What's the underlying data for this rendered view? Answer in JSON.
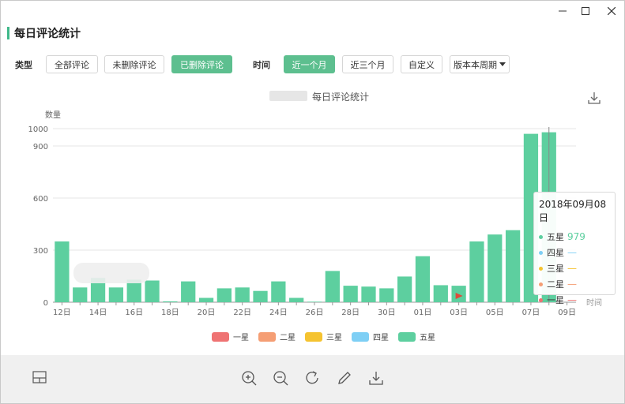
{
  "window": {
    "controls": {
      "minimize": "minimize",
      "maximize": "maximize",
      "close": "close"
    }
  },
  "page_title": "每日评论统计",
  "filters": {
    "type_label": "类型",
    "type_options": [
      "全部评论",
      "未删除评论",
      "已删除评论"
    ],
    "type_selected": "已删除评论",
    "time_label": "时间",
    "time_options": [
      "近一个月",
      "近三个月",
      "自定义"
    ],
    "time_selected": "近一个月",
    "version_dropdown": "版本本周期"
  },
  "chart_title": "每日评论统计",
  "colors": {
    "five": "#5dcf9f",
    "four": "#7ecff5",
    "three": "#f5c330",
    "two": "#f59e74",
    "one": "#ef7373",
    "accent": "#5dbf8f"
  },
  "chart_data": {
    "type": "bar",
    "ylabel": "数量",
    "xlabel": "时间",
    "ylim": [
      0,
      1000
    ],
    "yticks": [
      0,
      300,
      600,
      900,
      1000
    ],
    "categories": [
      "12日",
      "13日",
      "14日",
      "15日",
      "16日",
      "17日",
      "18日",
      "19日",
      "20日",
      "21日",
      "22日",
      "23日",
      "24日",
      "25日",
      "26日",
      "27日",
      "28日",
      "29日",
      "30日",
      "31日",
      "01日",
      "02日",
      "03日",
      "04日",
      "05日",
      "06日",
      "07日",
      "08日",
      "09日"
    ],
    "xtick_labels": [
      "12日",
      "14日",
      "16日",
      "18日",
      "20日",
      "22日",
      "24日",
      "26日",
      "28日",
      "30日",
      "01日",
      "03日",
      "05日",
      "07日",
      "09日"
    ],
    "series": [
      {
        "name": "一星",
        "values": [
          0,
          0,
          0,
          0,
          0,
          0,
          0,
          0,
          0,
          0,
          0,
          0,
          0,
          0,
          0,
          0,
          0,
          0,
          0,
          0,
          0,
          0,
          0,
          0,
          0,
          0,
          0,
          0
        ]
      },
      {
        "name": "二星",
        "values": [
          0,
          0,
          0,
          0,
          0,
          0,
          0,
          0,
          0,
          0,
          0,
          0,
          0,
          0,
          0,
          0,
          0,
          0,
          0,
          0,
          0,
          0,
          0,
          0,
          0,
          0,
          0,
          0
        ]
      },
      {
        "name": "三星",
        "values": [
          0,
          0,
          0,
          0,
          0,
          0,
          0,
          0,
          0,
          0,
          0,
          0,
          0,
          0,
          0,
          0,
          0,
          0,
          0,
          0,
          0,
          0,
          0,
          0,
          0,
          0,
          0,
          0
        ]
      },
      {
        "name": "四星",
        "values": [
          0,
          0,
          0,
          0,
          0,
          0,
          0,
          0,
          0,
          0,
          0,
          0,
          0,
          0,
          0,
          0,
          0,
          0,
          0,
          0,
          0,
          0,
          0,
          0,
          0,
          0,
          0,
          0
        ]
      },
      {
        "name": "五星",
        "values": [
          350,
          85,
          140,
          85,
          130,
          125,
          5,
          120,
          25,
          80,
          85,
          65,
          120,
          25,
          3,
          180,
          95,
          90,
          80,
          148,
          265,
          98,
          95,
          350,
          390,
          415,
          970,
          979
        ]
      }
    ],
    "legend": [
      "一星",
      "二星",
      "三星",
      "四星",
      "五星"
    ],
    "legend_position": "bottom",
    "grid": true
  },
  "tooltip": {
    "date": "2018年09月08日",
    "rows": [
      {
        "name": "五星",
        "value": "979"
      },
      {
        "name": "四星",
        "value": "—"
      },
      {
        "name": "三星",
        "value": "—"
      },
      {
        "name": "二星",
        "value": "—"
      },
      {
        "name": "一星",
        "value": "—"
      }
    ]
  },
  "toolbar": {
    "icons": [
      "layout-icon",
      "zoom-in-icon",
      "zoom-out-icon",
      "rotate-icon",
      "pen-icon",
      "download-icon"
    ]
  }
}
